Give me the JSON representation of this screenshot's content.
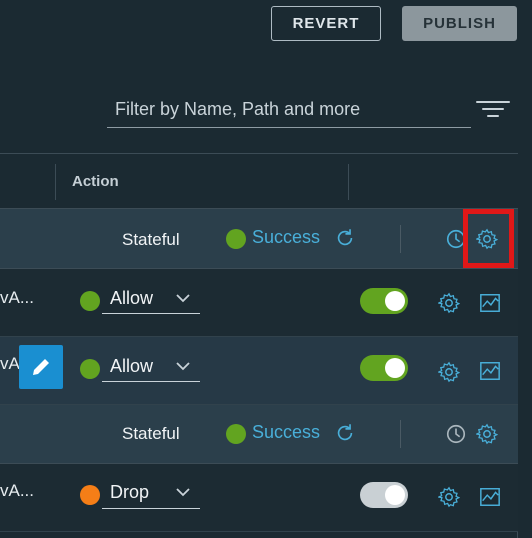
{
  "toolbar": {
    "revert_label": "REVERT",
    "publish_label": "PUBLISH"
  },
  "filter": {
    "placeholder": "Filter by Name, Path and more"
  },
  "table": {
    "header": {
      "action": "Action"
    },
    "groups": [
      {
        "type": "Stateful",
        "status": "Success",
        "status_color": "#62a420"
      },
      {
        "type": "Stateful",
        "status": "Success",
        "status_color": "#62a420"
      }
    ],
    "rules": [
      {
        "name_fragment": "vA...",
        "action": "Allow",
        "action_color": "#62a420",
        "enabled": true
      },
      {
        "name_fragment": "vA",
        "action": "Allow",
        "action_color": "#62a420",
        "enabled": true
      },
      {
        "name_fragment": "vA...",
        "action": "Drop",
        "action_color": "#f57e17",
        "enabled": false
      }
    ]
  },
  "colors": {
    "accent": "#49afd9",
    "toggle_on": "#62a420",
    "toggle_off": "#c9d0d4",
    "highlight": "#e01818",
    "edit_button": "#1a8fd1"
  },
  "icons": [
    "filter-icon",
    "refresh-icon",
    "clock-icon",
    "gear-icon",
    "chart-icon",
    "pencil-icon",
    "chevron-down-icon"
  ]
}
